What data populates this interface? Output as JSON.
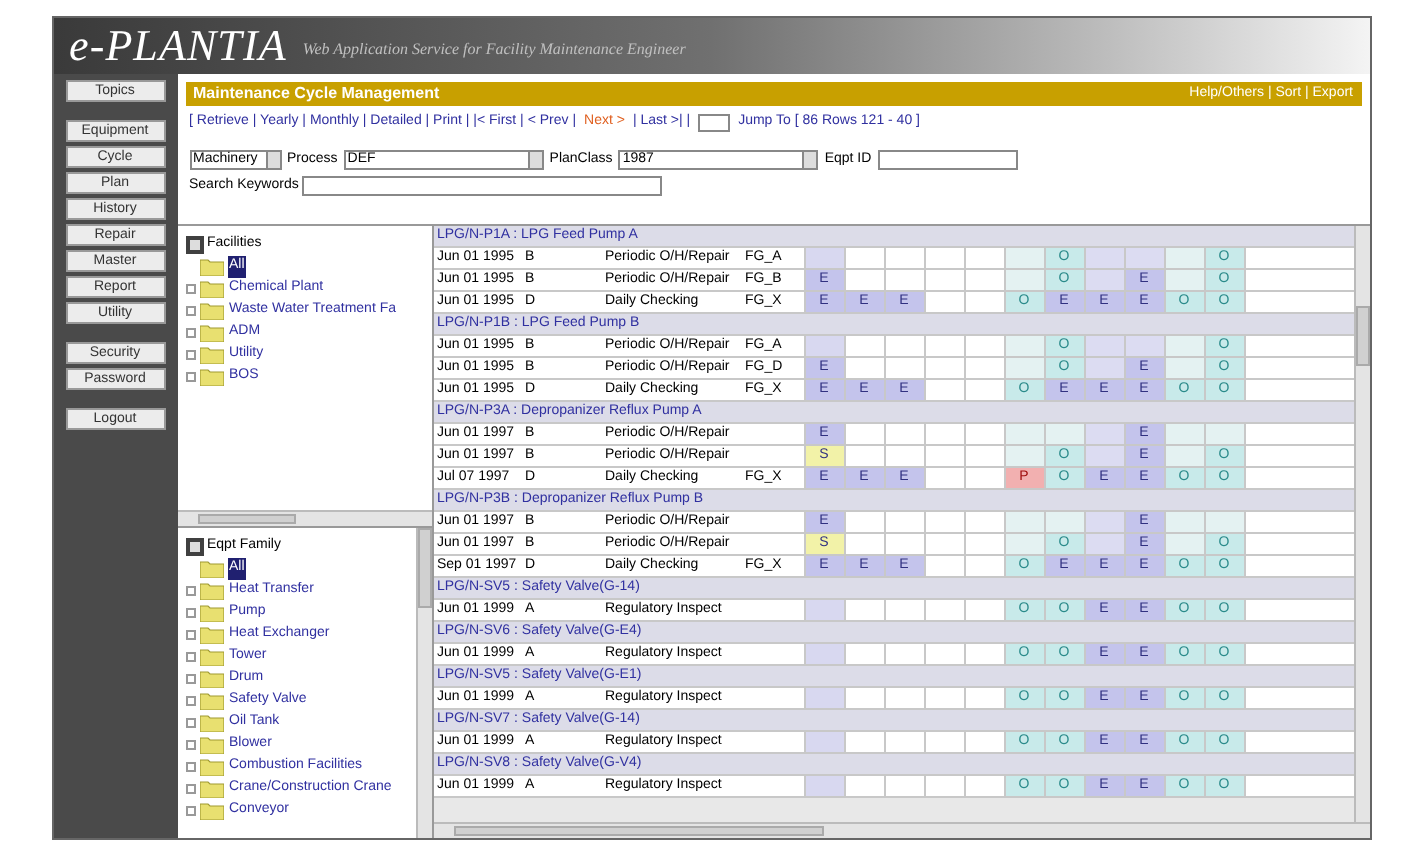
{
  "header": {
    "logo": "e-PLANTIA",
    "tagline": "Web Application Service for Facility Maintenance Engineer"
  },
  "nav": [
    {
      "buttons": [
        "Topics"
      ]
    },
    {
      "buttons": [
        "Equipment",
        "Cycle",
        "Plan",
        "History",
        "Repair",
        "Master",
        "Report",
        "Utility"
      ]
    },
    {
      "buttons": [
        "Security",
        "Password"
      ]
    },
    {
      "buttons": [
        "Logout"
      ]
    }
  ],
  "title_bar": {
    "title": "Maintenance Cycle Management",
    "links": "Help/Others | Sort | Export"
  },
  "toolbar": {
    "links": "[ Retrieve | Yearly | Monthly | Detailed | Print | |< First | < Prev |",
    "active": "Next >",
    "after": "| Last >| |",
    "jump": "Jump To [ 86 Rows 121 - 40 ]"
  },
  "filters": {
    "category": "Machinery",
    "process_label": "Process",
    "process": "DEF",
    "plan_label": "PlanClass",
    "plan": "1987",
    "eqpt_label": "Eqpt ID",
    "keywords_label": "Search Keywords"
  },
  "facility_tree": {
    "title": "Facilities",
    "items": [
      {
        "label": "All",
        "selected": true
      },
      {
        "label": "Chemical Plant",
        "selected": false
      },
      {
        "label": "Waste Water Treatment Fa",
        "selected": false
      },
      {
        "label": "ADM",
        "selected": false
      },
      {
        "label": "Utility",
        "selected": false
      },
      {
        "label": "BOS",
        "selected": false
      }
    ]
  },
  "family_tree": {
    "title": "Eqpt Family",
    "items": [
      {
        "label": "All",
        "selected": true
      },
      {
        "label": "Heat Transfer",
        "selected": false
      },
      {
        "label": "Pump",
        "selected": false
      },
      {
        "label": "Heat Exchanger",
        "selected": false
      },
      {
        "label": "Tower",
        "selected": false
      },
      {
        "label": "Drum",
        "selected": false
      },
      {
        "label": "Safety Valve",
        "selected": false
      },
      {
        "label": "Oil Tank",
        "selected": false
      },
      {
        "label": "Blower",
        "selected": false
      },
      {
        "label": "Combustion Facilities",
        "selected": false
      },
      {
        "label": "Crane/Construction Crane",
        "selected": false
      },
      {
        "label": "Conveyor",
        "selected": false
      }
    ]
  },
  "grid": {
    "groups": [
      {
        "title": "LPG/N-P1A : LPG Feed Pump A",
        "rows": [
          {
            "date": "Jun 01 1995",
            "code": "B",
            "task": "Periodic O/H/Repair",
            "fac": "FG_A",
            "cells": [
              "",
              "",
              "",
              "",
              "",
              "",
              "O",
              "",
              "",
              "",
              "O"
            ]
          },
          {
            "date": "Jun 01 1995",
            "code": "B",
            "task": "Periodic O/H/Repair",
            "fac": "FG_B",
            "cells": [
              "E",
              "",
              "",
              "",
              "",
              "",
              "O",
              "",
              "E",
              "",
              "O"
            ]
          },
          {
            "date": "Jun 01 1995",
            "code": "D",
            "task": "Daily Checking",
            "fac": "FG_X",
            "cells": [
              "E",
              "E",
              "E",
              "",
              "",
              "O",
              "E",
              "E",
              "E",
              "O",
              "O"
            ]
          }
        ]
      },
      {
        "title": "LPG/N-P1B : LPG Feed Pump B",
        "rows": [
          {
            "date": "Jun 01 1995",
            "code": "B",
            "task": "Periodic O/H/Repair",
            "fac": "FG_A",
            "cells": [
              "",
              "",
              "",
              "",
              "",
              "",
              "O",
              "",
              "",
              "",
              "O"
            ]
          },
          {
            "date": "Jun 01 1995",
            "code": "B",
            "task": "Periodic O/H/Repair",
            "fac": "FG_D",
            "cells": [
              "E",
              "",
              "",
              "",
              "",
              "",
              "O",
              "",
              "E",
              "",
              "O"
            ]
          },
          {
            "date": "Jun 01 1995",
            "code": "D",
            "task": "Daily Checking",
            "fac": "FG_X",
            "cells": [
              "E",
              "E",
              "E",
              "",
              "",
              "O",
              "E",
              "E",
              "E",
              "O",
              "O"
            ]
          }
        ]
      },
      {
        "title": "LPG/N-P3A : Depropanizer Reflux Pump A",
        "rows": [
          {
            "date": "Jun 01 1997",
            "code": "B",
            "task": "Periodic O/H/Repair",
            "cells": [
              "E",
              "",
              "",
              "",
              "",
              "",
              "",
              "",
              "E",
              "",
              ""
            ]
          },
          {
            "date": "Jun 01 1997",
            "code": "B",
            "task": "Periodic O/H/Repair",
            "cells": [
              "S",
              "",
              "",
              "",
              "",
              "",
              "O",
              "",
              "E",
              "",
              "O"
            ]
          },
          {
            "date": "Jul 07 1997",
            "code": "D",
            "task": "Daily Checking",
            "fac": "FG_X",
            "cells": [
              "E",
              "E",
              "E",
              "",
              "",
              "P",
              "O",
              "E",
              "E",
              "O",
              "O"
            ]
          }
        ]
      },
      {
        "title": "LPG/N-P3B : Depropanizer Reflux Pump B",
        "rows": [
          {
            "date": "Jun 01 1997",
            "code": "B",
            "task": "Periodic O/H/Repair",
            "cells": [
              "E",
              "",
              "",
              "",
              "",
              "",
              "",
              "",
              "E",
              "",
              ""
            ]
          },
          {
            "date": "Jun 01 1997",
            "code": "B",
            "task": "Periodic O/H/Repair",
            "cells": [
              "S",
              "",
              "",
              "",
              "",
              "",
              "O",
              "",
              "E",
              "",
              "O"
            ]
          },
          {
            "date": "Sep 01 1997",
            "code": "D",
            "task": "Daily Checking",
            "fac": "FG_X",
            "cells": [
              "E",
              "E",
              "E",
              "",
              "",
              "O",
              "E",
              "E",
              "E",
              "O",
              "O"
            ]
          }
        ]
      },
      {
        "title": "LPG/N-SV5 : Safety Valve(G-14)",
        "rows": [
          {
            "date": "Jun 01 1999",
            "code": "A",
            "task": "Regulatory Inspect",
            "cells": [
              "",
              "",
              "",
              "",
              "",
              "O",
              "O",
              "E",
              "E",
              "O",
              "O"
            ]
          }
        ]
      },
      {
        "title": "LPG/N-SV6 : Safety Valve(G-E4)",
        "rows": [
          {
            "date": "Jun 01 1999",
            "code": "A",
            "task": "Regulatory Inspect",
            "cells": [
              "",
              "",
              "",
              "",
              "",
              "O",
              "O",
              "E",
              "E",
              "O",
              "O"
            ]
          }
        ]
      },
      {
        "title": "LPG/N-SV5 : Safety Valve(G-E1)",
        "rows": [
          {
            "date": "Jun 01 1999",
            "code": "A",
            "task": "Regulatory Inspect",
            "cells": [
              "",
              "",
              "",
              "",
              "",
              "O",
              "O",
              "E",
              "E",
              "O",
              "O"
            ]
          }
        ]
      },
      {
        "title": "LPG/N-SV7 : Safety Valve(G-14)",
        "rows": [
          {
            "date": "Jun 01 1999",
            "code": "A",
            "task": "Regulatory Inspect",
            "cells": [
              "",
              "",
              "",
              "",
              "",
              "O",
              "O",
              "E",
              "E",
              "O",
              "O"
            ]
          }
        ]
      },
      {
        "title": "LPG/N-SV8 : Safety Valve(G-V4)",
        "rows": [
          {
            "date": "Jun 01 1999",
            "code": "A",
            "task": "Regulatory Inspect",
            "cells": [
              "",
              "",
              "",
              "",
              "",
              "O",
              "O",
              "E",
              "E",
              "O",
              "O"
            ]
          }
        ]
      }
    ]
  }
}
